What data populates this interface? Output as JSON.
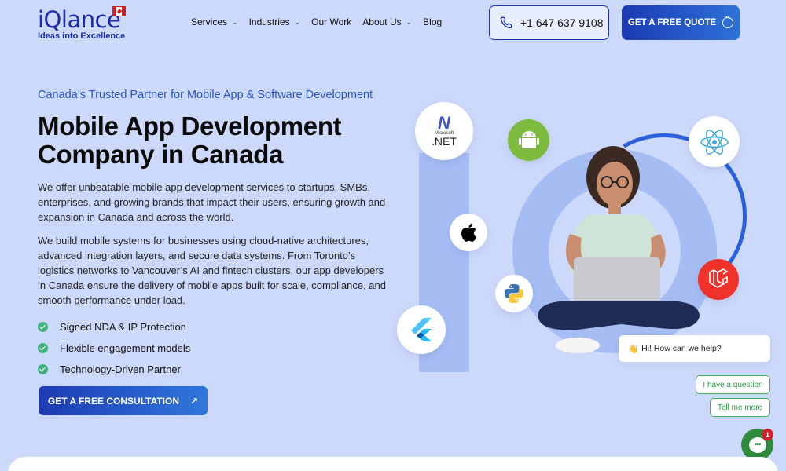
{
  "brand": {
    "logo_text": "iQlance",
    "logo_tagline": "Ideas into Excellence"
  },
  "nav": {
    "items": [
      {
        "label": "Services",
        "dropdown": true
      },
      {
        "label": "Industries",
        "dropdown": true
      },
      {
        "label": "Our Work",
        "dropdown": false
      },
      {
        "label": "About Us",
        "dropdown": true
      },
      {
        "label": "Blog",
        "dropdown": false
      }
    ],
    "phone": "+1 647 637 9108",
    "quote_label": "GET A FREE QUOTE"
  },
  "hero": {
    "tagline": "Canada’s Trusted Partner for Mobile App & Software Development",
    "title_line1": "Mobile App Development",
    "title_line2": "Company in Canada",
    "paragraph1": "We offer unbeatable mobile app development services to startups, SMBs, enterprises, and growing brands that impact their users, ensuring growth and expansion in Canada and across the world.",
    "paragraph2": "We build mobile systems for businesses using cloud-native architectures, advanced integration layers, and secure data systems. From Toronto’s logistics networks to Vancouver’s AI and fintech clusters, our app developers in Canada ensure the delivery of mobile apps built for scale, compliance, and smooth performance under load.",
    "features": [
      "Signed NDA & IP Protection",
      "Flexible engagement models",
      "Technology-Driven Partner"
    ],
    "cta_label": "GET A FREE CONSULTATION"
  },
  "tech_icons": {
    "net_label_1": "Microsoft",
    "net_label_2": ".NET"
  },
  "chat": {
    "greeting": "Hi! How can we help?",
    "option1": "I have a question",
    "option2": "Tell me more",
    "unread_count": "1"
  },
  "colors": {
    "background": "#cdd9fb",
    "primary": "#1d3bb4",
    "accent": "#2855c8",
    "check": "#3fb27f",
    "chat_green": "#2e8b3b"
  }
}
